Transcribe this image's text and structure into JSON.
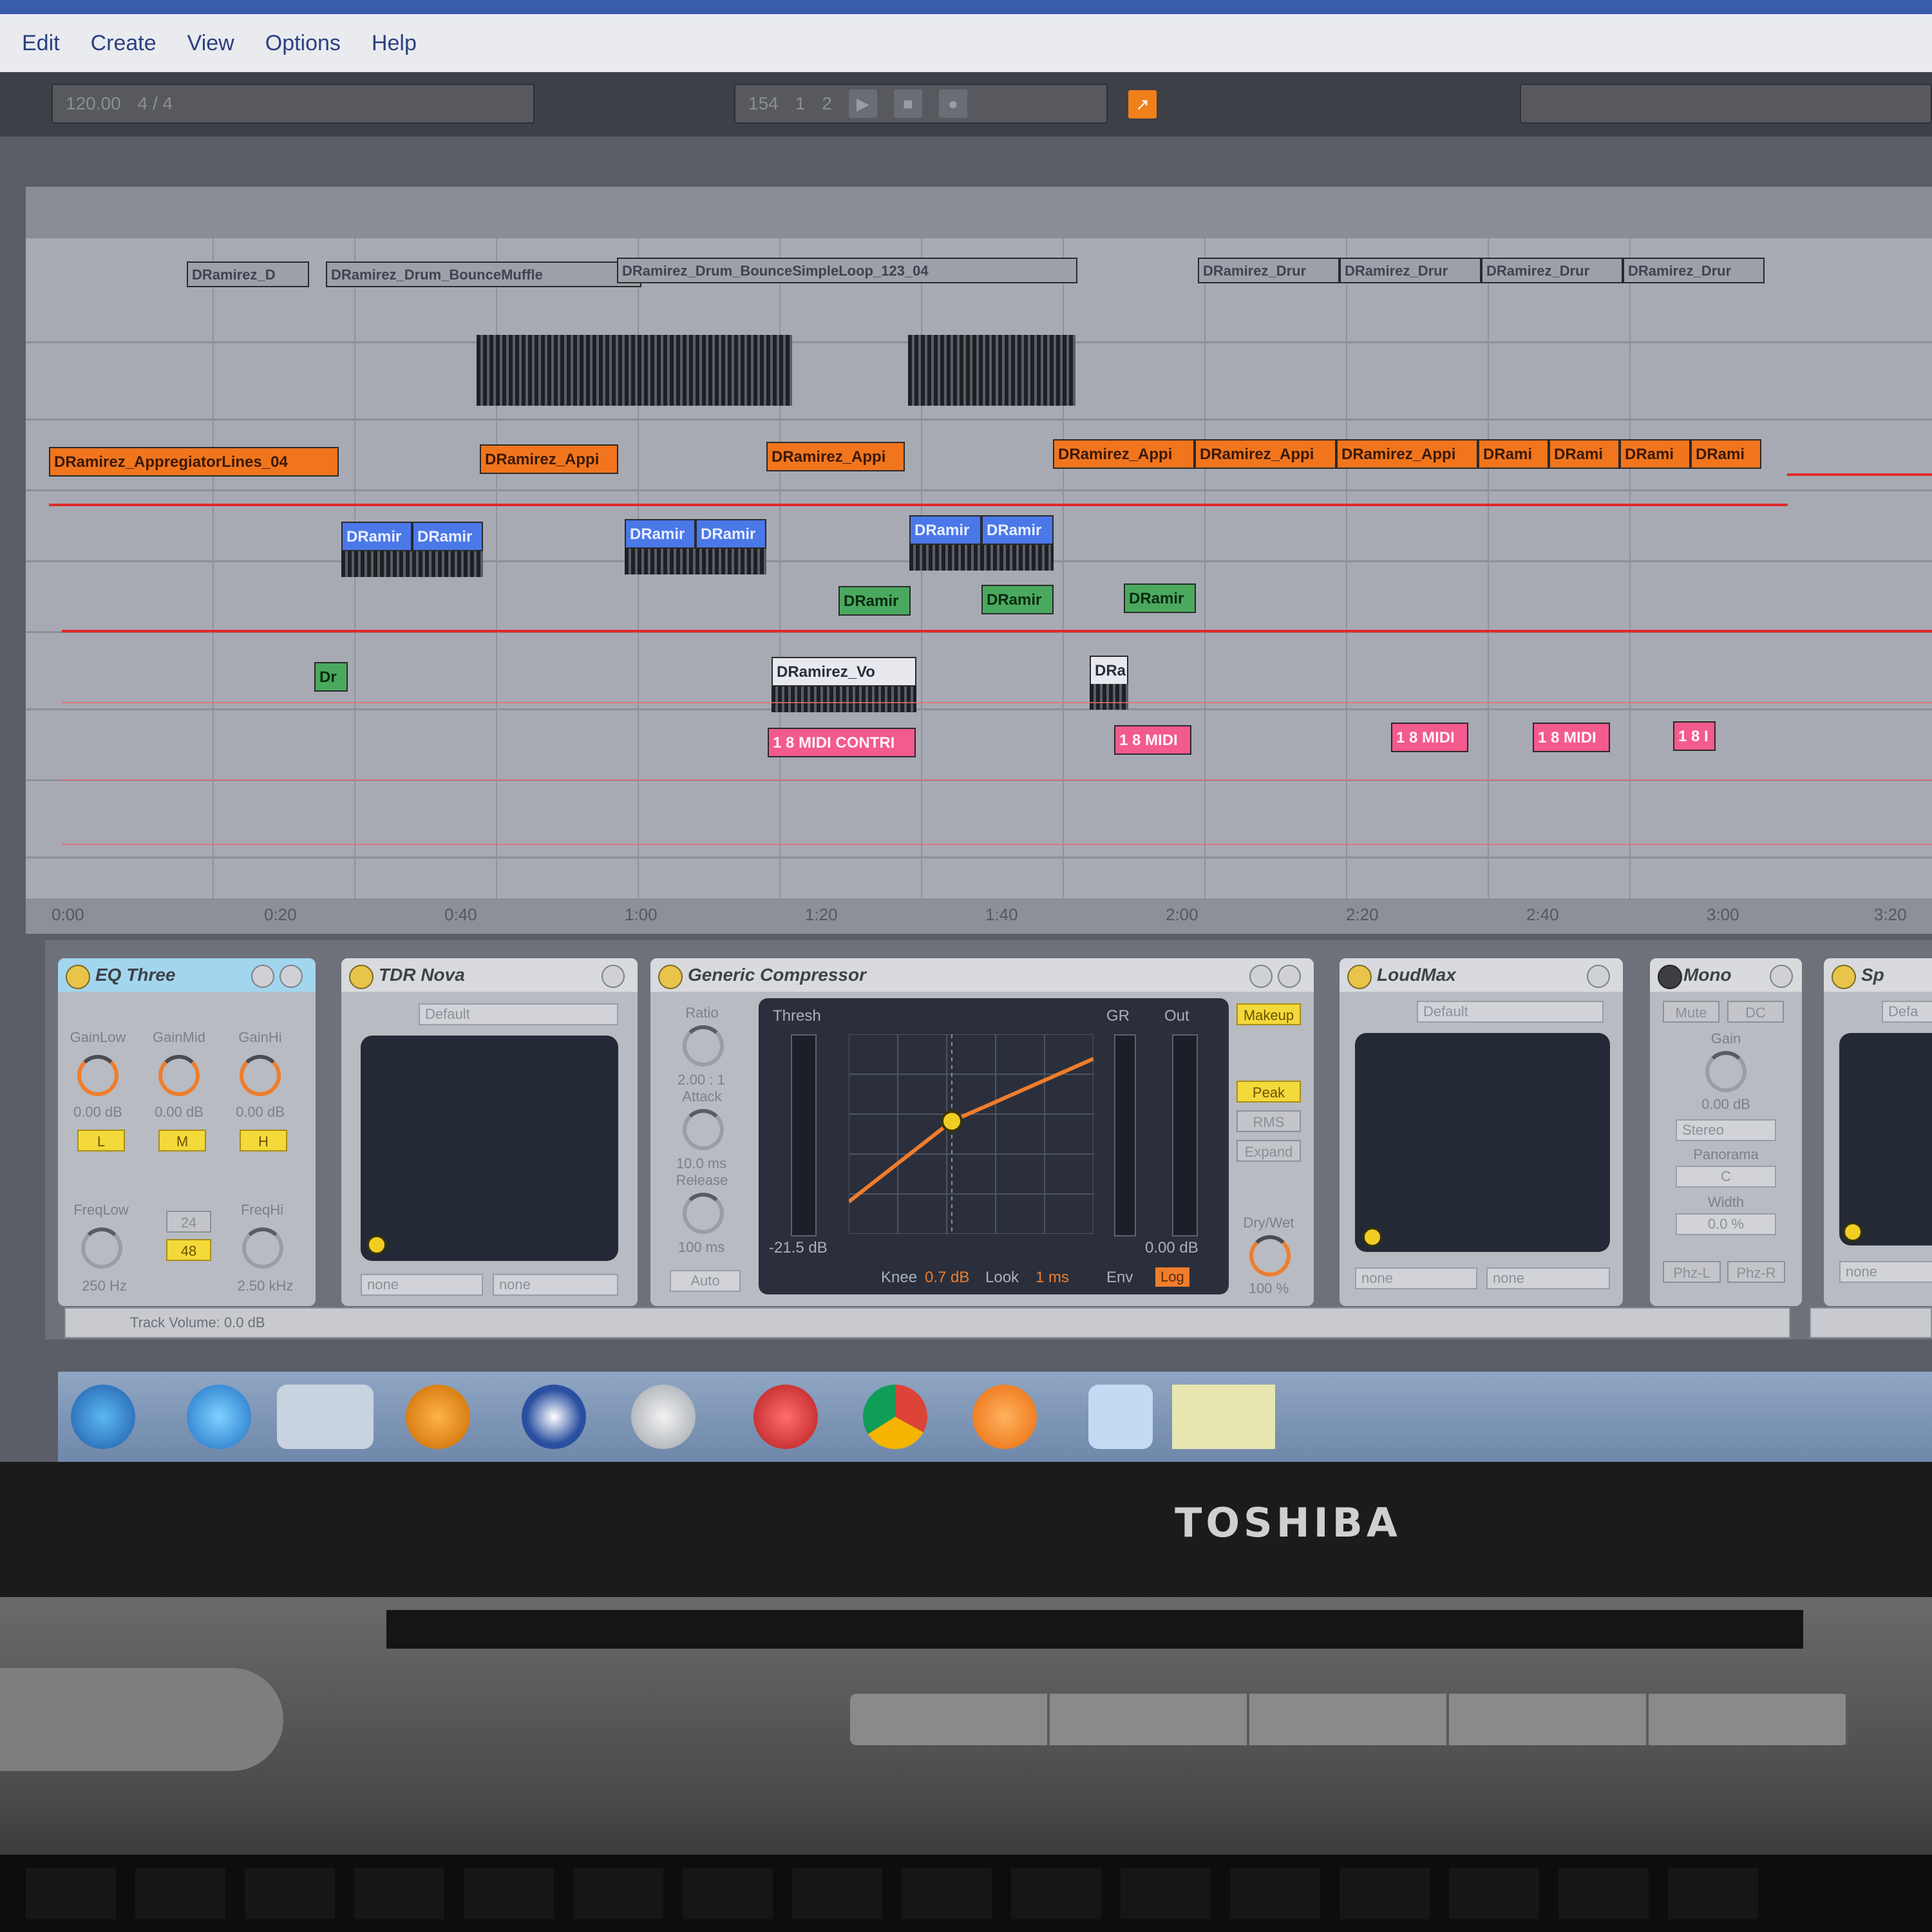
{
  "menu": [
    "Edit",
    "Create",
    "View",
    "Options",
    "Help"
  ],
  "toolbar": {
    "tempo": "120.00",
    "meter": "4 / 4",
    "position": [
      "154",
      "1",
      "2"
    ]
  },
  "arrangement": {
    "clips_row1": [
      "DRamirez_D",
      "DRamirez_Drum_BounceMuffle",
      "DRamirez_Drum_BounceSimpleLoop_123_04",
      "DRamirez_Drur",
      "DRamirez_Drur",
      "DRamirez_Drur",
      "DRamirez_Drur"
    ],
    "clips_orange": [
      "DRamirez_AppregiatorLines_04",
      "DRamirez_Appi",
      "DRamirez_Appi",
      "DRamirez_Appi",
      "DRamirez_Appi",
      "DRamirez_Appi",
      "DRami",
      "DRami",
      "DRami",
      "DRami"
    ],
    "clips_blue": [
      "DRamir",
      "DRamir",
      "DRamir",
      "DRamir",
      "DRamir",
      "DRamir"
    ],
    "clips_green": [
      "DRamir",
      "DRamir",
      "DRamir"
    ],
    "clip_vocal": "DRamirez_Vo",
    "clip_small": "DRa",
    "clip_dr": "Dr",
    "clips_midi": [
      "1 8 MIDI CONTRI",
      "1 8 MIDI",
      "1 8 MIDI",
      "1 8 MIDI",
      "1 8 I"
    ],
    "ruler": [
      "0:00",
      "0:20",
      "0:40",
      "1:00",
      "1:20",
      "1:40",
      "2:00",
      "2:20",
      "2:40",
      "3:00",
      "3:20"
    ]
  },
  "devices": {
    "eq": {
      "title": "EQ Three",
      "labels": [
        "GainLow",
        "GainMid",
        "GainHi"
      ],
      "values": [
        "0.00 dB",
        "0.00 dB",
        "0.00 dB"
      ],
      "bands": [
        "L",
        "M",
        "H"
      ],
      "freq_labels": [
        "FreqLow",
        "FreqHi"
      ],
      "freq_values": [
        "250 Hz",
        "2.50 kHz"
      ],
      "slope": [
        "24",
        "48"
      ]
    },
    "nova": {
      "title": "TDR Nova",
      "preset": "Default",
      "routes": [
        "none",
        "none"
      ]
    },
    "comp": {
      "title": "Generic Compressor",
      "ratio_label": "Ratio",
      "ratio_value": "2.00 : 1",
      "attack_label": "Attack",
      "attack_value": "10.0 ms",
      "release_label": "Release",
      "release_value": "100 ms",
      "auto": "Auto",
      "thresh": "Thresh",
      "gr": "GR",
      "out": "Out",
      "thresh_value": "-21.5 dB",
      "out_value": "0.00 dB",
      "knee_label": "Knee",
      "knee_value": "0.7 dB",
      "look_label": "Look",
      "look_value": "1 ms",
      "env_label": "Env",
      "env_value": "Log",
      "makeup": "Makeup",
      "modes": [
        "Peak",
        "RMS",
        "Expand"
      ],
      "drywet_label": "Dry/Wet",
      "drywet_value": "100 %"
    },
    "loudmax": {
      "title": "LoudMax",
      "preset": "Default",
      "routes": [
        "none",
        "none"
      ]
    },
    "mono": {
      "title": "Mono",
      "buttons": [
        "Mute",
        "DC"
      ],
      "gain_label": "Gain",
      "gain_value": "0.00 dB",
      "mode": "Stereo",
      "pan_label": "Panorama",
      "pan_value": "C",
      "width_label": "Width",
      "width_value": "0.0 %",
      "phase": [
        "Phz-L",
        "Phz-R"
      ]
    },
    "last": {
      "title": "Sp",
      "preset": "Defa",
      "route": "none"
    }
  },
  "status": "Track Volume: 0.0 dB",
  "taskbar": [
    "start",
    "internet-explorer",
    "file-explorer",
    "media-player",
    "person-app",
    "clock-app",
    "pin-app",
    "chrome",
    "avast",
    "notes-app",
    "live"
  ],
  "brand": "TOSHIBA"
}
